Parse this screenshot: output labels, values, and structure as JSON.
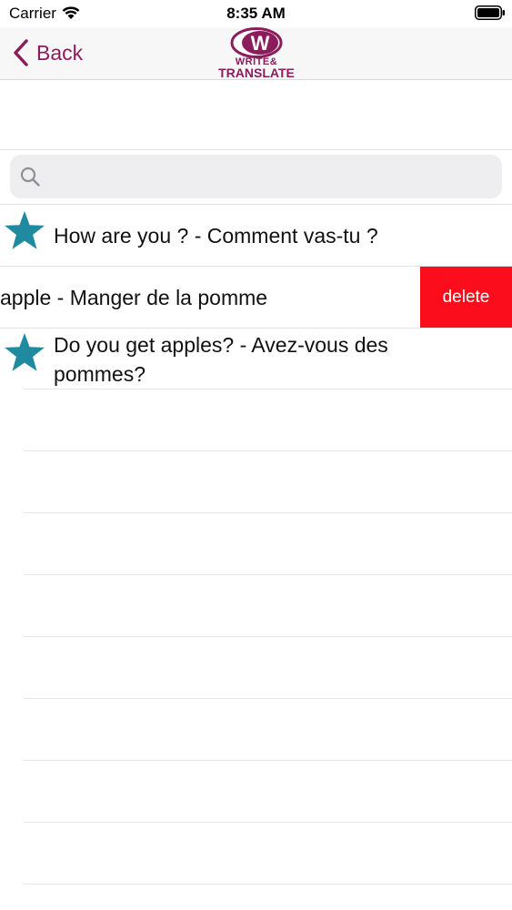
{
  "status_bar": {
    "carrier": "Carrier",
    "time": "8:35 AM"
  },
  "nav": {
    "back_label": "Back",
    "logo_letter": "W",
    "logo_line1": "WRITE&",
    "logo_line2": "TRANSLATE"
  },
  "search": {
    "placeholder": "",
    "value": ""
  },
  "rows": [
    {
      "text": "How are you ? - Comment vas-tu ?",
      "starred": true
    },
    {
      "text": "apple - Manger de la pomme",
      "swiped": true,
      "delete_label": "delete"
    },
    {
      "text": "Do you get apples? - Avez-vous des pommes?",
      "starred": true
    }
  ],
  "colors": {
    "brand": "#8c1d5c",
    "star": "#1f8aa0",
    "delete": "#fc0d1b"
  }
}
